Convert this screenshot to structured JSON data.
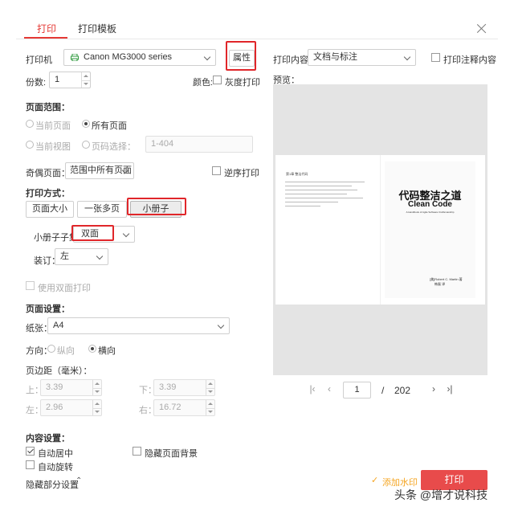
{
  "tabs": [
    {
      "label": "打印"
    },
    {
      "label": "打印模板"
    }
  ],
  "printer": {
    "label": "打印机",
    "selected": "Canon MG3000 series",
    "properties_label": "属性",
    "copies_label": "份数:",
    "copies_value": "1",
    "color_label": "颜色:",
    "grayscale_label": "灰度打印"
  },
  "page_range": {
    "title": "页面范围：",
    "current_page": "当前页面",
    "all_pages": "所有页面",
    "current_view": "当前视图",
    "page_select": "页码选择：",
    "page_select_placeholder": "1-404"
  },
  "odd_even": {
    "label": "奇偶页面：",
    "selected": "范围中所有页面",
    "reverse_label": "逆序打印"
  },
  "print_mode": {
    "title": "打印方式：",
    "buttons": [
      "页面大小",
      "一张多页",
      "小册子"
    ],
    "booklet_subset_label": "小册子子集",
    "booklet_subset_value": "双面",
    "binding_label": "装订：",
    "binding_value": "左",
    "duplex_label": "使用双面打印"
  },
  "page_setup": {
    "title": "页面设置：",
    "paper_label": "纸张：",
    "paper_value": "A4",
    "orientation_label": "方向：",
    "portrait": "纵向",
    "landscape": "横向",
    "margin_title": "页边距（毫米）：",
    "top_label": "上：",
    "top_value": "3.39",
    "bottom_label": "下：",
    "bottom_value": "3.39",
    "left_label": "左：",
    "left_value": "2.96",
    "right_label": "右：",
    "right_value": "16.72"
  },
  "content_settings": {
    "title": "内容设置：",
    "center_label": "自动居中",
    "hide_bg_label": "隐藏页面背景",
    "rotate_label": "自动旋转",
    "hide_partial_label": "隐藏部分设置"
  },
  "right_panel": {
    "content_label": "打印内容：",
    "content_value": "文档与标注",
    "annotation_label": "打印注释内容",
    "preview_label": "预览："
  },
  "preview_page": {
    "left_header": "第1章  整洁代码",
    "cover_title": "代码整洁之道",
    "cover_subtitle": "Clean Code",
    "cover_tagline": "A Handbook of Agile Software Craftsmanship",
    "cover_author": "[美]Robert C. Martin  著",
    "cover_translator": "韩磊  译"
  },
  "pager": {
    "current": "1",
    "separator": "/",
    "total": "202"
  },
  "footer": {
    "watermark_label": "添加水印",
    "print_label": "打印"
  },
  "overlay": {
    "watermark": "头条 @增才说科技"
  },
  "colors": {
    "accent": "#e53935",
    "print_button": "#e84b4b",
    "highlight_box": "#e0262a",
    "preview_bg": "#e4e4e4",
    "link_orange": "#f5a623"
  }
}
